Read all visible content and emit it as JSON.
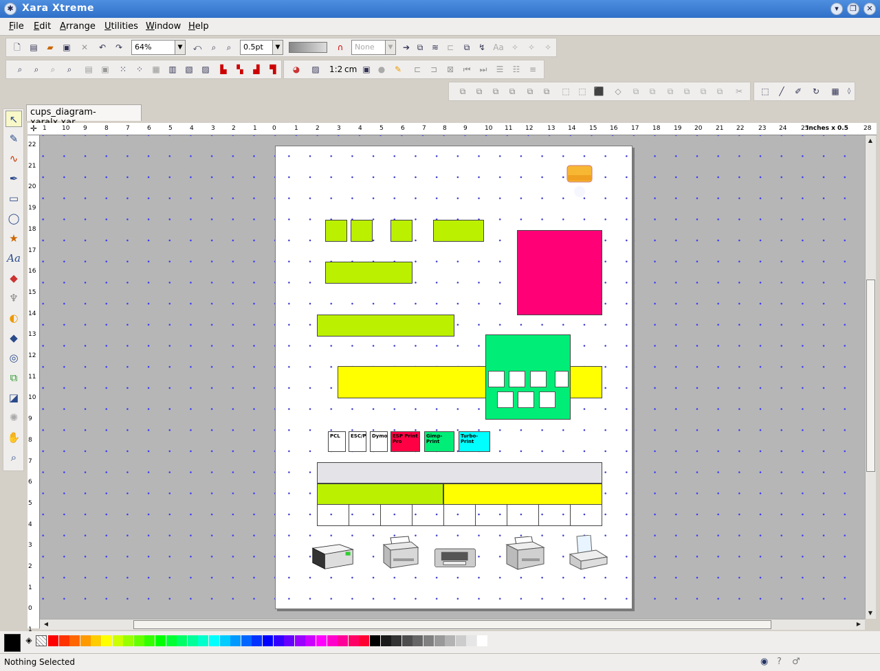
{
  "window": {
    "title": "Xara Xtreme"
  },
  "menu": [
    "File",
    "Edit",
    "Arrange",
    "Utilities",
    "Window",
    "Help"
  ],
  "toolbar": {
    "zoom_value": "64%",
    "line_width_value": "0.5pt",
    "arrow_value": "None",
    "scale_label": "1:2",
    "unit_label": "cm"
  },
  "document_tab": "cups_diagram-xaralx.xar",
  "ruler": {
    "h_ticks": [
      "1",
      "10",
      "9",
      "8",
      "7",
      "6",
      "5",
      "4",
      "3",
      "2",
      "1",
      "0",
      "1",
      "2",
      "3",
      "4",
      "5",
      "6",
      "7",
      "8",
      "9",
      "10",
      "11",
      "12",
      "13",
      "14",
      "15",
      "16",
      "17",
      "18",
      "19",
      "20",
      "21",
      "22",
      "23",
      "24",
      "25",
      "28"
    ],
    "h_units": "Inches x 0.5",
    "v_ticks": [
      "22",
      "21",
      "20",
      "19",
      "18",
      "17",
      "16",
      "15",
      "14",
      "13",
      "12",
      "11",
      "10",
      "9",
      "8",
      "7",
      "6",
      "5",
      "4",
      "3",
      "2",
      "1",
      "0",
      "1"
    ]
  },
  "diagram": {
    "labels": [
      "PCL",
      "ESC/P",
      "Dymo",
      "ESP Print Pro",
      "Gimp-Print",
      "Turbo-Print"
    ],
    "colors": {
      "lime": "#bbf000",
      "yellow": "#ffff00",
      "magenta": "#ff0077",
      "green": "#00ee77",
      "red": "#ff0044",
      "cyan": "#00ffff"
    }
  },
  "status": {
    "text": "Nothing Selected"
  }
}
